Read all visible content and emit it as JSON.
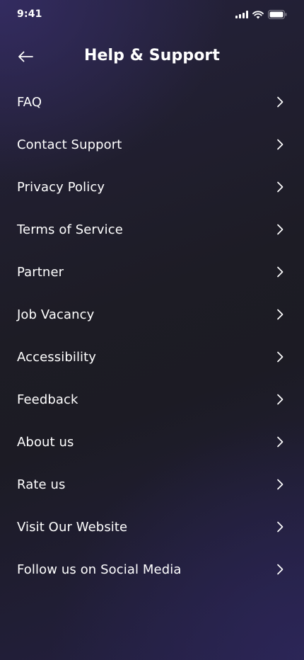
{
  "status_bar": {
    "time": "9:41",
    "icons": [
      "cellular-signal-icon",
      "wifi-icon",
      "battery-icon"
    ]
  },
  "header": {
    "back_icon": "arrow-left-icon",
    "title": "Help & Support"
  },
  "menu": {
    "chevron_icon": "chevron-right-icon",
    "items": [
      {
        "label": "FAQ"
      },
      {
        "label": "Contact Support"
      },
      {
        "label": "Privacy Policy"
      },
      {
        "label": "Terms of Service"
      },
      {
        "label": "Partner"
      },
      {
        "label": "Job Vacancy"
      },
      {
        "label": "Accessibility"
      },
      {
        "label": "Feedback"
      },
      {
        "label": "About us"
      },
      {
        "label": "Rate us"
      },
      {
        "label": "Visit Our Website"
      },
      {
        "label": "Follow us on Social Media"
      }
    ]
  },
  "theme": {
    "background_top": "#2c2650",
    "background_mid": "#1c1b24",
    "background_bottom": "#262246",
    "text_color": "#ffffff"
  }
}
